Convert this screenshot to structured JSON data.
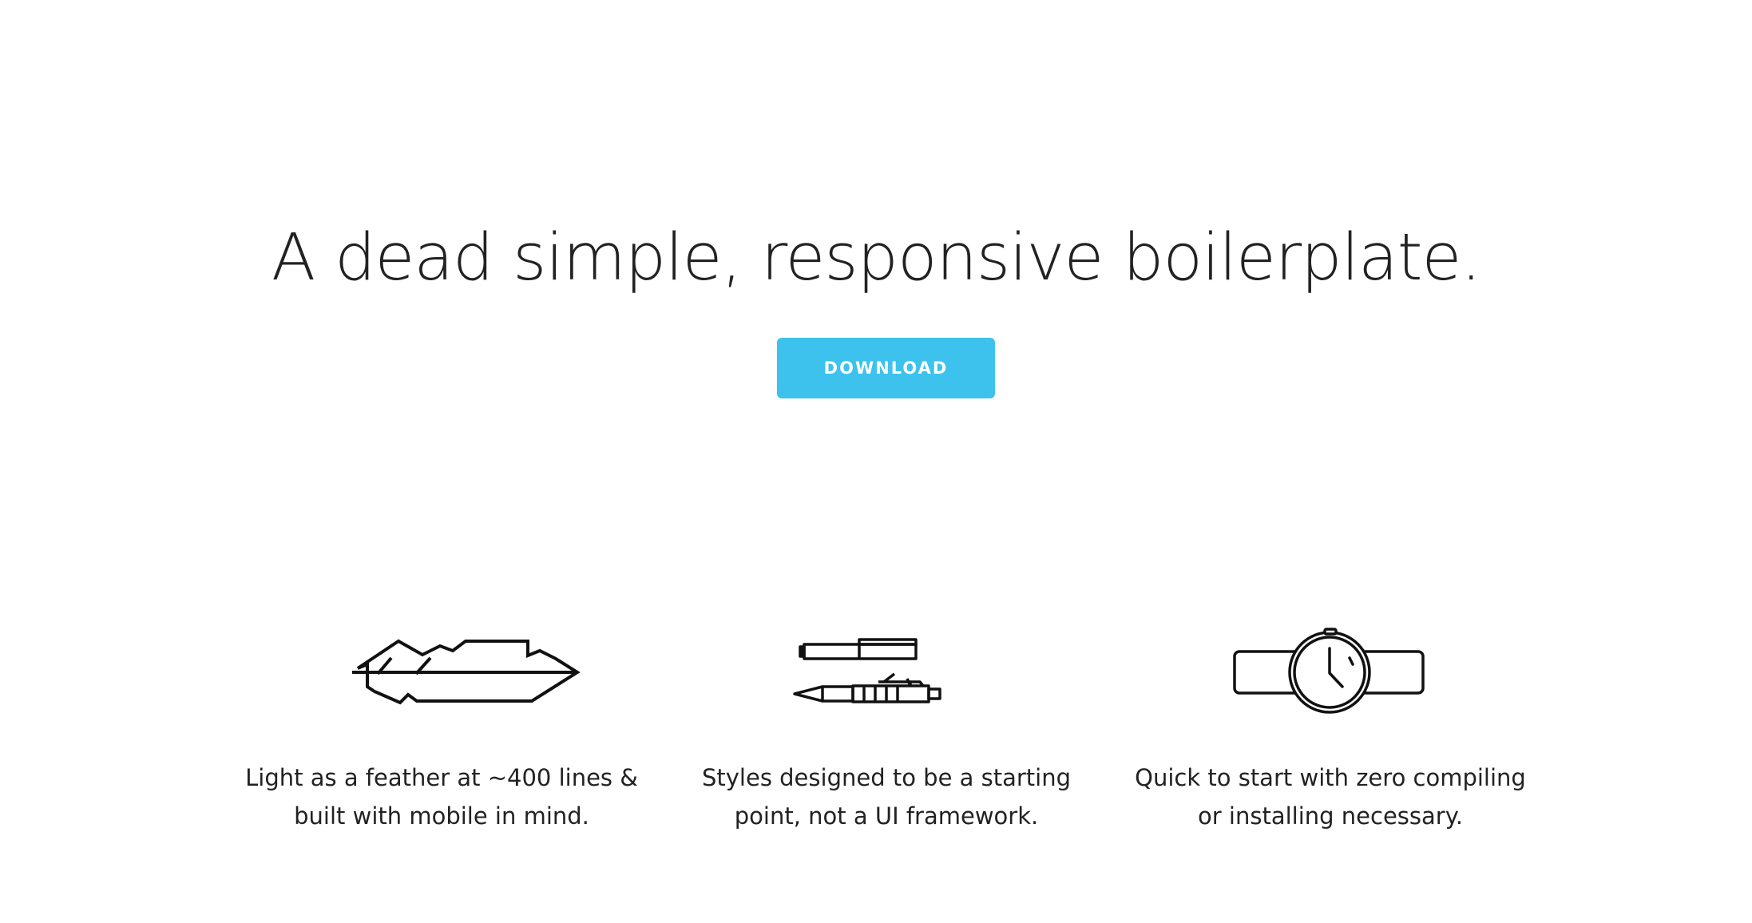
{
  "hero": {
    "title": "A dead simple, responsive boilerplate.",
    "button_label": "DOWNLOAD",
    "button_color": "#3dc2ed"
  },
  "features": [
    {
      "icon": "feather-icon",
      "line1": "Light as a feather at ~400 lines &",
      "line2": "built with mobile in mind."
    },
    {
      "icon": "pens-icon",
      "line1": "Styles designed to be a starting",
      "line2": "point, not a UI framework."
    },
    {
      "icon": "watch-icon",
      "line1": "Quick to start with zero compiling",
      "line2": "or installing necessary."
    }
  ]
}
